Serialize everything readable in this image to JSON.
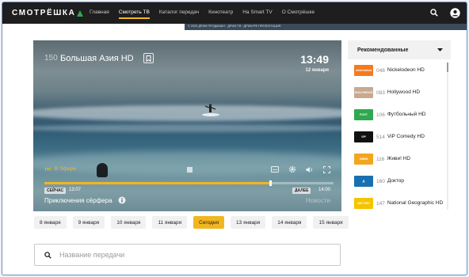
{
  "header": {
    "logo": "СМОТРЁШКА",
    "nav": [
      "Главная",
      "Смотреть ТВ",
      "Каталог передач",
      "Кинотеатр",
      "На Smart TV",
      "О Смотрёшке"
    ],
    "active_nav_index": 1,
    "icons": [
      "search-icon",
      "account-icon"
    ],
    "promo": "© 2020 ДРИМ ПРОДАКШН · ДРИМ ТВ · ДРИМ.РФ ПРЕЗЕНТАЦИЯ"
  },
  "player": {
    "channel_number": "150",
    "channel_name": "Большая Азия HD",
    "time": "13:49",
    "date": "12 января",
    "live_label": "В Эфире",
    "now_label": "СЕЙЧАС",
    "start_time": "13:07",
    "next_label": "ДАЛЕЕ",
    "end_time": "14:00",
    "program_title": "Приключения сёрфера",
    "next_program": "Новости",
    "progress": 0.78
  },
  "recommended": {
    "title": "Рекомендованные",
    "items": [
      {
        "num": "048",
        "name": "Nickelodeon HD",
        "logo_color": "#f47b20",
        "logo_text": "nickelodeon"
      },
      {
        "num": "083",
        "name": "Hollywood HD",
        "logo_color": "#c7a98f",
        "logo_text": "HOLLYWOOD"
      },
      {
        "num": "106",
        "name": "Футбольный HD",
        "logo_color": "#2fa84f",
        "logo_text": "FOOT"
      },
      {
        "num": "514",
        "name": "ViP Comedy HD",
        "logo_color": "#111111",
        "logo_text": "VIP"
      },
      {
        "num": "116",
        "name": "Живи! HD",
        "logo_color": "#f2a51f",
        "logo_text": "ЖИВИ"
      },
      {
        "num": "160",
        "name": "Доктор",
        "logo_color": "#1a6fb0",
        "logo_text": "Д"
      },
      {
        "num": "147",
        "name": "National Geographic HD",
        "logo_color": "#f5c400",
        "logo_text": "NAT GEO"
      }
    ]
  },
  "dates": [
    "8 января",
    "9 января",
    "10 января",
    "11 января",
    "Сегодня",
    "13 января",
    "14 января",
    "15 января"
  ],
  "active_date_index": 4,
  "search": {
    "placeholder": "Название передачи"
  },
  "colors": {
    "accent": "#f2b61f",
    "header_bg": "#1e1e1e",
    "logo_mark": "#2fa84f"
  }
}
